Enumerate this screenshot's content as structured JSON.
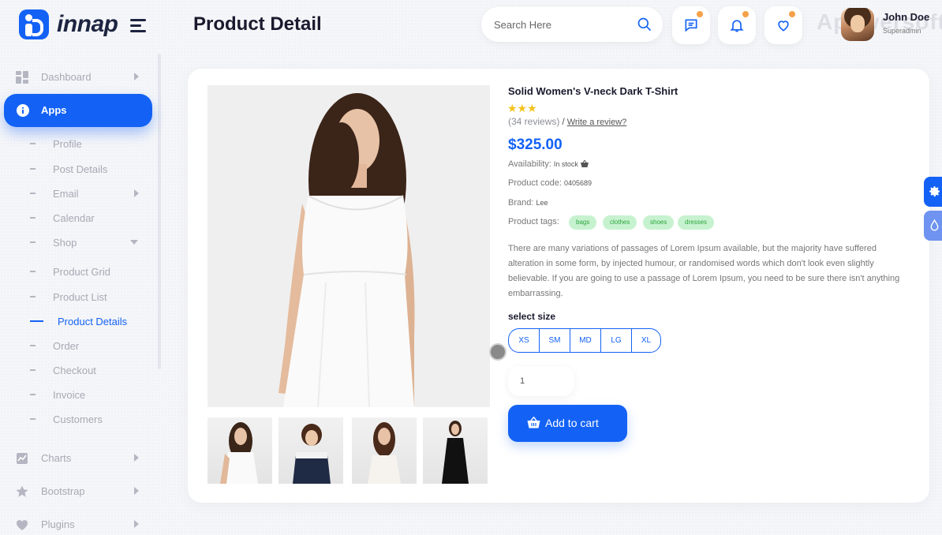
{
  "brand": {
    "name": "innap"
  },
  "header": {
    "title": "Product Detail",
    "search": {
      "placeholder": "Search Here",
      "value": ""
    },
    "watermark": "Apowersoft",
    "user": {
      "name": "John Doe",
      "role": "Superadmin"
    }
  },
  "sidebar": {
    "items": [
      {
        "label": "Dashboard",
        "icon": "dashboard-icon"
      },
      {
        "label": "Apps",
        "icon": "info-icon",
        "active": true
      },
      {
        "label": "Charts",
        "icon": "chart-icon"
      },
      {
        "label": "Bootstrap",
        "icon": "star-icon"
      },
      {
        "label": "Plugins",
        "icon": "heart-icon"
      }
    ],
    "apps_sub": [
      {
        "label": "Profile"
      },
      {
        "label": "Post Details"
      },
      {
        "label": "Email"
      },
      {
        "label": "Calendar"
      },
      {
        "label": "Shop"
      }
    ],
    "shop_sub": [
      {
        "label": "Product Grid"
      },
      {
        "label": "Product List"
      },
      {
        "label": "Product Details",
        "active": true
      },
      {
        "label": "Order"
      },
      {
        "label": "Checkout"
      },
      {
        "label": "Invoice"
      },
      {
        "label": "Customers"
      }
    ]
  },
  "product": {
    "title": "Solid Women's V-neck Dark T-Shirt",
    "stars": "★★★",
    "rating": 3,
    "reviews_text": "(34 reviews)",
    "separator": "/",
    "write_review": "Write a review?",
    "price": "$325.00",
    "availability_label": "Availability:",
    "availability_value": "In stock",
    "code_label": "Product code:",
    "code_value": "0405689",
    "brand_label": "Brand:",
    "brand_value": "Lee",
    "tags_label": "Product tags:",
    "tags": [
      "bags",
      "clothes",
      "shoes",
      "dresses"
    ],
    "description": "There are many variations of passages of Lorem Ipsum available, but the majority have suffered alteration in some form, by injected humour, or randomised words which don't look even slightly believable. If you are going to use a passage of Lorem Ipsum, you need to be sure there isn't anything embarrassing.",
    "size_title": "select size",
    "sizes": [
      "XS",
      "SM",
      "MD",
      "LG",
      "XL"
    ],
    "quantity": "1",
    "add_to_cart": "Add to cart"
  },
  "colors": {
    "accent": "#1362f5",
    "star": "#f4c21b",
    "tag_bg": "#c7f2cf",
    "tag_text": "#2ba63f",
    "notification_dot": "#f6a14a"
  }
}
